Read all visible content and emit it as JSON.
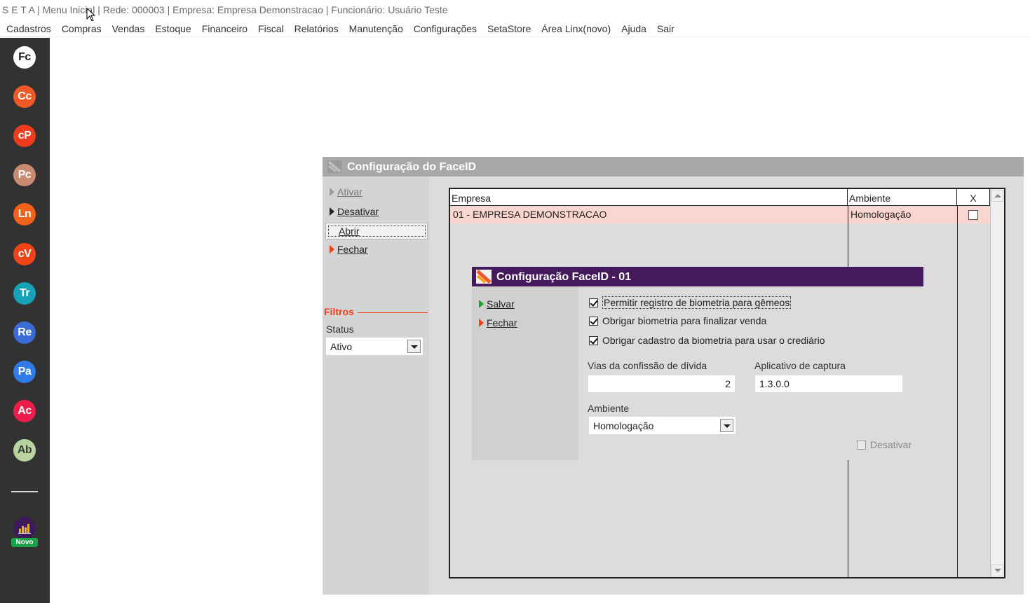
{
  "window_title": "S E T A | Menu Inicial | Rede: 000003 | Empresa: Empresa Demonstracao | Funcionário: Usuário Teste",
  "menu": [
    "Cadastros",
    "Compras",
    "Vendas",
    "Estoque",
    "Financeiro",
    "Fiscal",
    "Relatórios",
    "Manutenção",
    "Configurações",
    "SetaStore",
    "Área Linx(novo)",
    "Ajuda",
    "Sair"
  ],
  "sidebar": {
    "apps": [
      {
        "label": "Fc",
        "color": "#ffffff",
        "text_color": "#1a1a1a"
      },
      {
        "label": "Cc",
        "color": "#f05a28"
      },
      {
        "label": "cP",
        "color": "#f03c1e"
      },
      {
        "label": "Pc",
        "color": "#c98a72"
      },
      {
        "label": "Ln",
        "color": "#f0621a"
      },
      {
        "label": "cV",
        "color": "#f04418"
      },
      {
        "label": "Tr",
        "color": "#17a2b8"
      },
      {
        "label": "Re",
        "color": "#3b6bd6"
      },
      {
        "label": "Pa",
        "color": "#2f7be8"
      },
      {
        "label": "Ac",
        "color": "#ee1c4a"
      },
      {
        "label": "Ab",
        "color": "#b9d4a0",
        "text_color": "#3b3b3b"
      }
    ],
    "new_badge": "Novo"
  },
  "main_window": {
    "title": "Configuração do FaceID",
    "actions": {
      "ativar": "Ativar",
      "desativar": "Desativar",
      "abrir": "Abrir",
      "fechar": "Fechar"
    },
    "filters_label": "Filtros",
    "status_label": "Status",
    "status_value": "Ativo",
    "grid": {
      "columns": [
        "Empresa",
        "Ambiente",
        "X"
      ],
      "rows": [
        {
          "empresa": "01 - EMPRESA DEMONSTRACAO",
          "ambiente": "Homologação",
          "x": false
        }
      ]
    }
  },
  "dialog": {
    "title": "Configuração FaceID - 01",
    "actions": {
      "salvar": "Salvar",
      "fechar": "Fechar"
    },
    "checkboxes": {
      "gemeos": {
        "label": "Permitir registro de biometria para gêmeos",
        "checked": true
      },
      "finalizar_venda": {
        "label": "Obrigar biometria para finalizar venda",
        "checked": true
      },
      "crediario": {
        "label": "Obrigar cadastro da biometria para usar o crediário",
        "checked": true
      },
      "desativar": {
        "label": "Desativar",
        "checked": false
      }
    },
    "vias_label": "Vias da confissão de dívida",
    "vias_value": "2",
    "aplicativo_label": "Aplicativo de captura",
    "aplicativo_value": "1.3.0.0",
    "ambiente_label": "Ambiente",
    "ambiente_value": "Homologação"
  }
}
